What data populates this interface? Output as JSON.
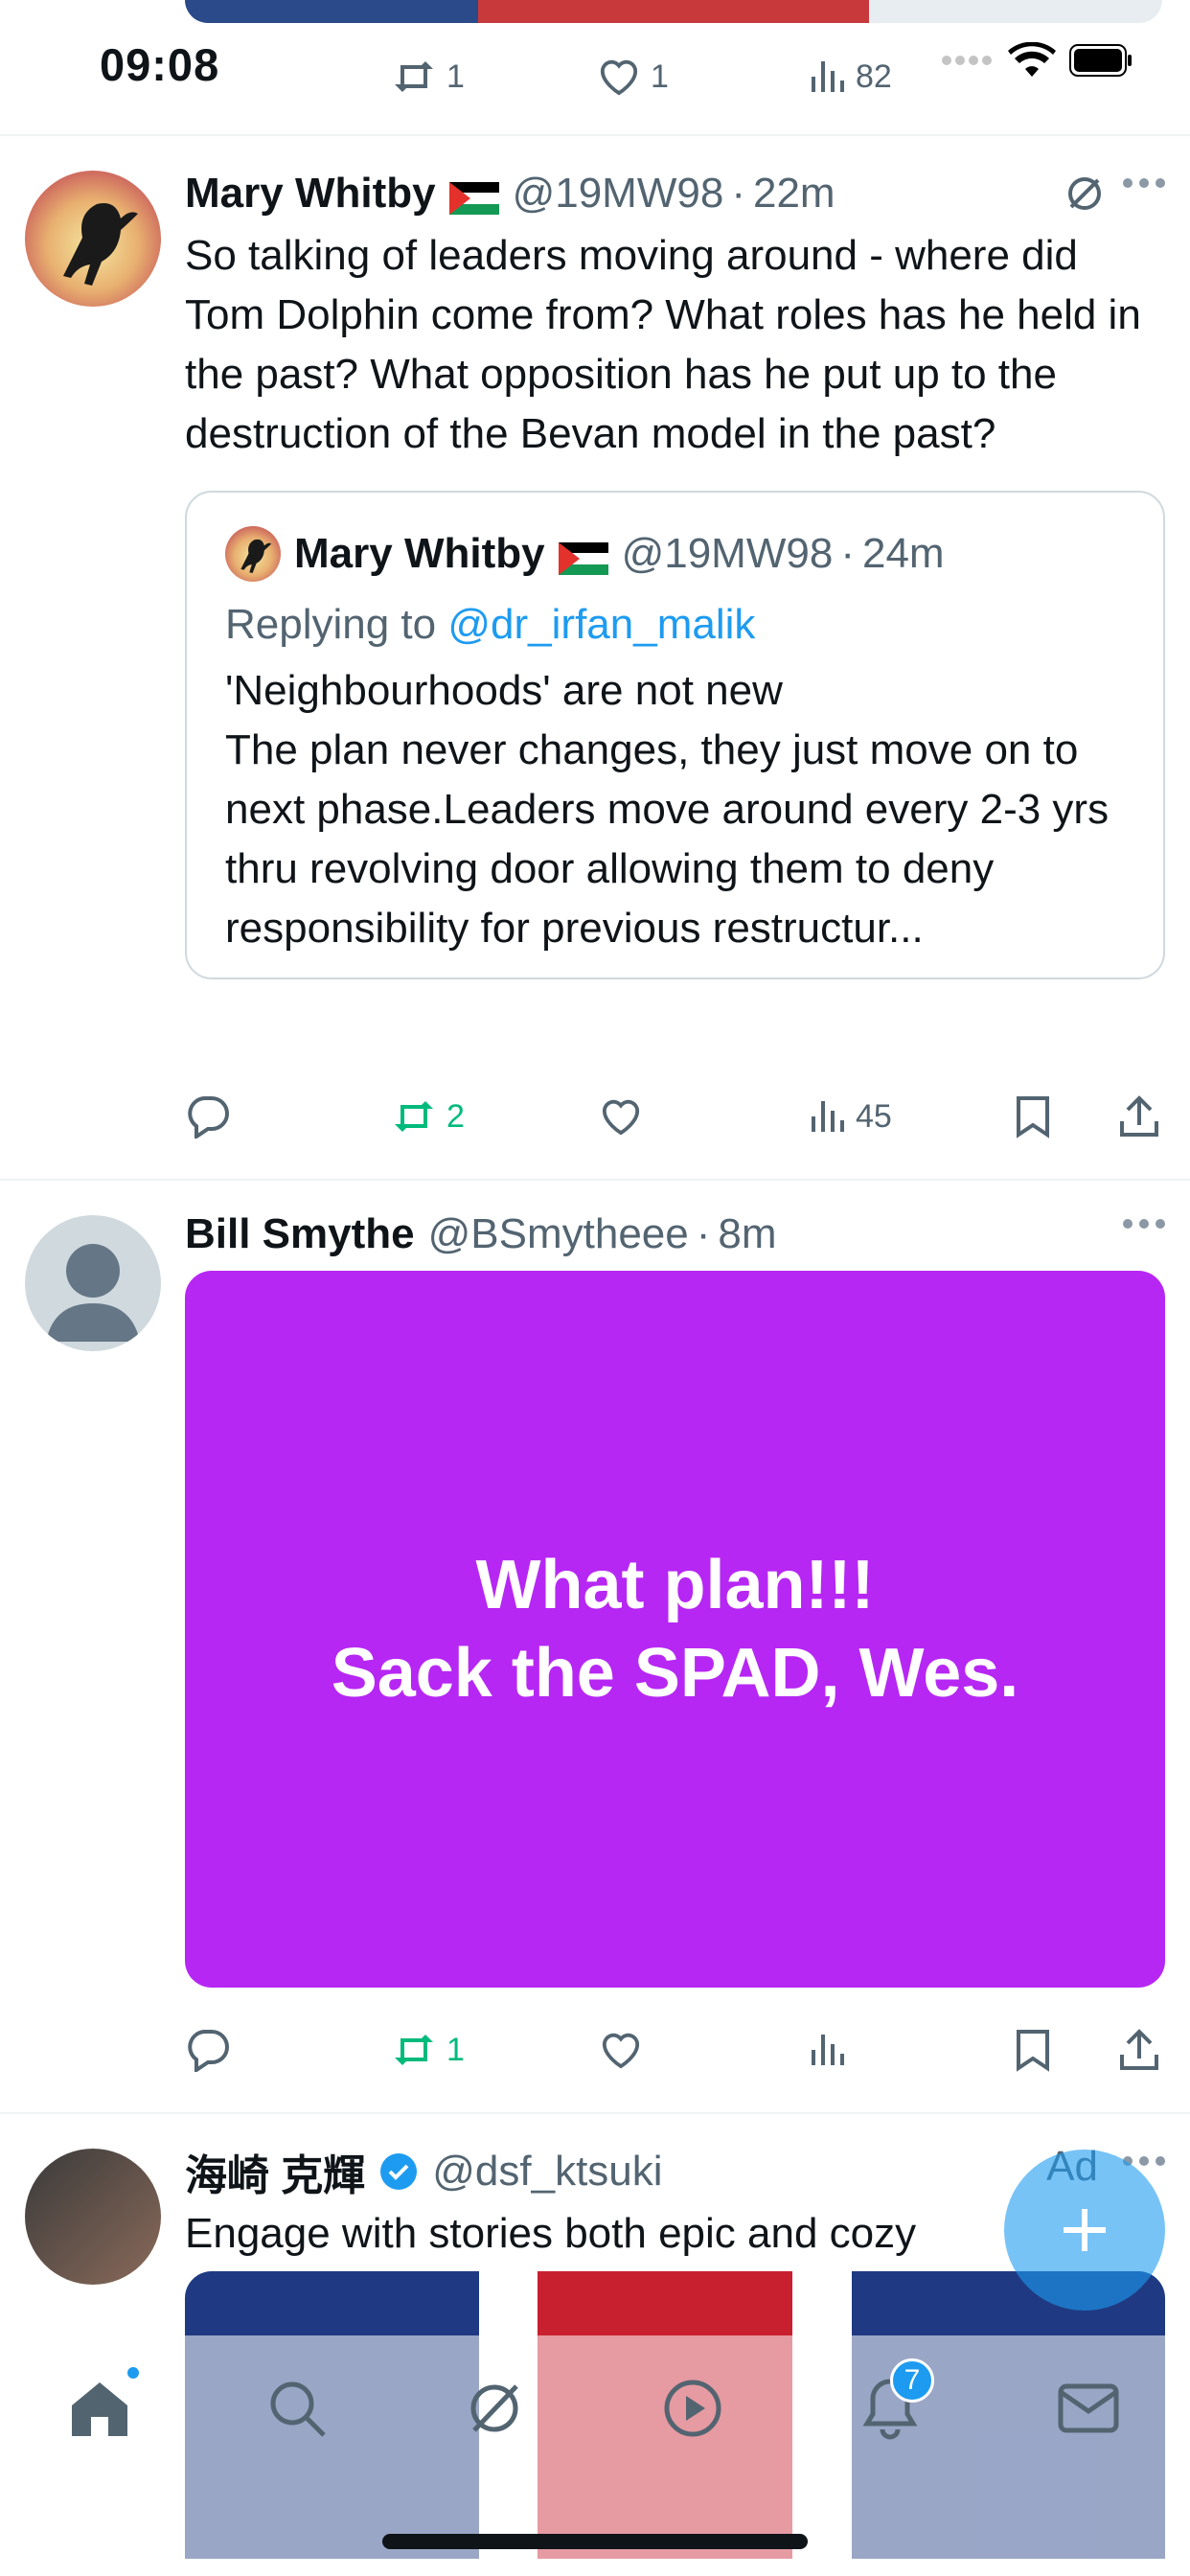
{
  "status_bar": {
    "time": "09:08"
  },
  "top_tweet_actions": {
    "retweets": "1",
    "likes": "1",
    "views": "82"
  },
  "tweets": [
    {
      "name": "Mary Whitby",
      "handle": "@19MW98",
      "time": "22m",
      "text": "So talking of leaders moving around - where did Tom Dolphin come from? What roles has he held in the past? What opposition has he put up to the destruction of the Bevan model in the past?",
      "quote": {
        "name": "Mary Whitby",
        "handle": "@19MW98",
        "time": "24m",
        "replying_prefix": "Replying to",
        "replying_to": "@dr_irfan_malik",
        "text": "'Neighbourhoods' are not new\nThe plan never changes, they just move on to next phase.Leaders move around every 2-3 yrs thru revolving door allowing them to deny responsibility for previous restructur..."
      },
      "actions": {
        "retweets": "2",
        "views": "45"
      }
    },
    {
      "name": "Bill Smythe",
      "handle": "@BSmytheee",
      "time": "8m",
      "media_text_1": "What plan!!!",
      "media_text_2": "Sack the SPAD, Wes.",
      "actions": {
        "retweets": "1"
      }
    },
    {
      "name": "海崎 克輝",
      "handle": "@dsf_ktsuki",
      "ad_label": "Ad",
      "text": "Engage with stories both epic and cozy"
    }
  ],
  "tabbar": {
    "notifications_badge": "7"
  },
  "colors": {
    "accent": "#1d9bf0",
    "retweet_green": "#00ba7c",
    "media_purple": "#b627f3"
  }
}
